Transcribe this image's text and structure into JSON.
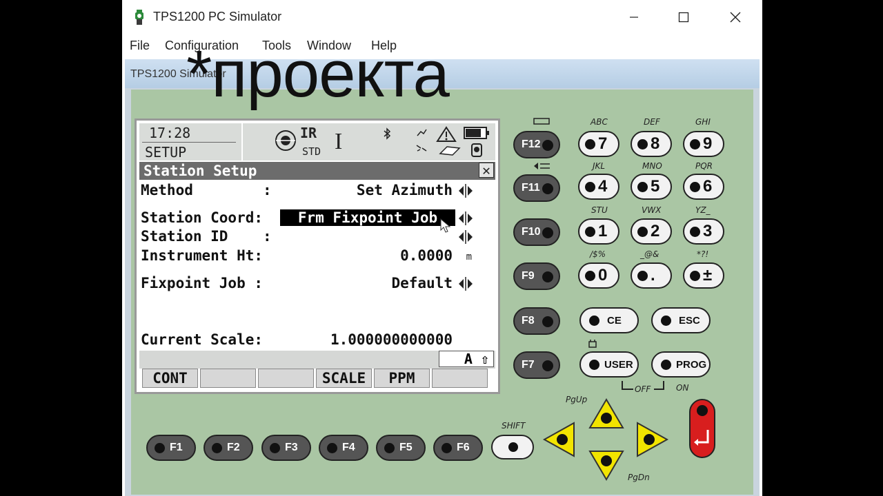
{
  "window": {
    "title": "TPS1200 PC Simulator",
    "minimize": "—",
    "maximize": "☐",
    "close": "✕"
  },
  "menu": [
    "File",
    "Configuration",
    "Tools",
    "Window",
    "Help"
  ],
  "inner_title": "TPS1200 Simulator",
  "overlay_text": "*проекта",
  "status": {
    "time": "17:28",
    "mode": "SETUP",
    "ir": "IR",
    "std": "STD",
    "cursor_char": "I"
  },
  "dialog": {
    "title": "Station Setup",
    "close": "✕",
    "fields": [
      {
        "label": "Method        :",
        "value": "Set Azimuth"
      },
      {
        "label": "Station Coord:",
        "value": "Frm Fixpoint Job"
      },
      {
        "label": "Station ID    :",
        "value": ""
      },
      {
        "label": "Instrument Ht:",
        "value": "0.0000",
        "unit": "m"
      },
      {
        "label": "Fixpoint Job :",
        "value": "Default"
      },
      {
        "label": "Current Scale:",
        "value": "1.000000000000"
      }
    ],
    "case_indicator": "A ⇧",
    "softkeys": [
      "CONT",
      "",
      "",
      "SCALE",
      "PPM",
      ""
    ]
  },
  "keypad": {
    "fkeys_right": [
      "F12",
      "F11",
      "F10",
      "F9",
      "F8",
      "F7"
    ],
    "num_rows": [
      [
        {
          "letters": "ABC",
          "key": "7"
        },
        {
          "letters": "DEF",
          "key": "8"
        },
        {
          "letters": "GHI",
          "key": "9"
        }
      ],
      [
        {
          "letters": "JKL",
          "key": "4"
        },
        {
          "letters": "MNO",
          "key": "5"
        },
        {
          "letters": "PQR",
          "key": "6"
        }
      ],
      [
        {
          "letters": "STU",
          "key": "1"
        },
        {
          "letters": "VWX",
          "key": "2"
        },
        {
          "letters": "YZ_",
          "key": "3"
        }
      ],
      [
        {
          "letters": "/$%",
          "key": "0"
        },
        {
          "letters": "_@&",
          "key": "."
        },
        {
          "letters": "*?!",
          "key": "±"
        }
      ]
    ],
    "ce": "CE",
    "esc": "ESC",
    "user": "USER",
    "prog": "PROG",
    "off_label": "OFF",
    "on_label": "ON",
    "shift_label": "SHIFT",
    "pgup_label": "PgUp",
    "pgdn_label": "PgDn",
    "fkeys_bottom": [
      "F1",
      "F2",
      "F3",
      "F4",
      "F5",
      "F6"
    ],
    "colors": {
      "face": "#aac6a4",
      "arrow": "#f2e400",
      "enter": "#d81e1e"
    }
  }
}
